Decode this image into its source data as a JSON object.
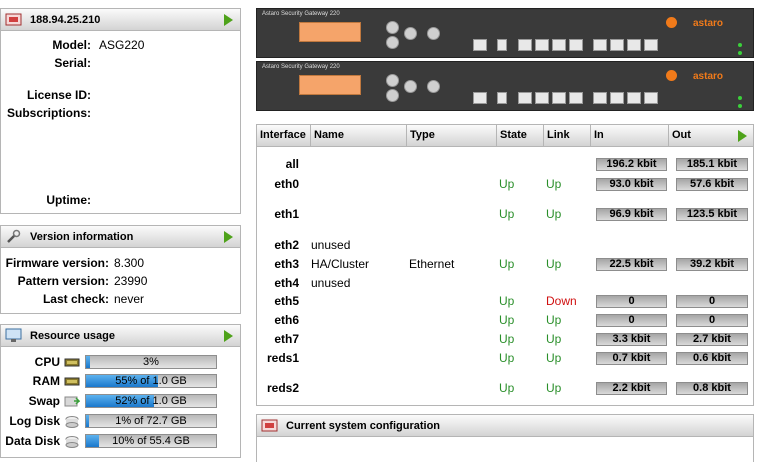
{
  "system": {
    "host": "188.94.25.210",
    "labels": {
      "model": "Model:",
      "serial": "Serial:",
      "license": "License ID:",
      "subscriptions": "Subscriptions:",
      "uptime": "Uptime:"
    },
    "model": "ASG220"
  },
  "version": {
    "title": "Version information",
    "labels": {
      "firmware": "Firmware version:",
      "pattern": "Pattern version:",
      "last_check": "Last check:"
    },
    "firmware": "8.300",
    "pattern": "23990",
    "last_check": "never"
  },
  "resources": {
    "title": "Resource usage",
    "items": [
      {
        "label": "CPU",
        "text": "3%",
        "pct": 3
      },
      {
        "label": "RAM",
        "text": "55% of 1.0 GB",
        "pct": 55
      },
      {
        "label": "Swap",
        "text": "52% of 1.0 GB",
        "pct": 52
      },
      {
        "label": "Log Disk",
        "text": "1% of 72.7 GB",
        "pct": 1
      },
      {
        "label": "Data Disk",
        "text": "10% of 55.4 GB",
        "pct": 10
      }
    ]
  },
  "gateway": {
    "title": "Astaro Security Gateway 220",
    "logo": "astaro",
    "port_groups": [
      "COM",
      "USB 2.0",
      "10/100/1000 PCI-X",
      "10/100/1000 PCI-X"
    ],
    "port_labels": [
      "LAN",
      "WAN",
      "DMZ",
      "HA"
    ],
    "buttons": [
      "Esc",
      "Enter"
    ],
    "leds": [
      "Power",
      "HDD"
    ]
  },
  "interfaces": {
    "headers": {
      "interface": "Interface",
      "name": "Name",
      "type": "Type",
      "state": "State",
      "link": "Link",
      "in": "In",
      "out": "Out"
    },
    "rows": [
      {
        "iface": "all",
        "name": "",
        "type": "",
        "state": "",
        "link": "",
        "in": "196.2 kbit",
        "out": "185.1 kbit"
      },
      {
        "iface": "eth0",
        "name": "",
        "type": "",
        "state": "Up",
        "link": "Up",
        "in": "93.0 kbit",
        "out": "57.6 kbit"
      },
      {
        "iface": "eth1",
        "name": "",
        "type": "",
        "state": "Up",
        "link": "Up",
        "in": "96.9 kbit",
        "out": "123.5 kbit"
      },
      {
        "iface": "eth2",
        "name": "unused",
        "type": "",
        "state": "",
        "link": "",
        "in": "",
        "out": ""
      },
      {
        "iface": "eth3",
        "name": "HA/Cluster",
        "type": "Ethernet",
        "state": "Up",
        "link": "Up",
        "in": "22.5 kbit",
        "out": "39.2 kbit"
      },
      {
        "iface": "eth4",
        "name": "unused",
        "type": "",
        "state": "",
        "link": "",
        "in": "",
        "out": ""
      },
      {
        "iface": "eth5",
        "name": "",
        "type": "",
        "state": "Up",
        "link": "Down",
        "in": "0",
        "out": "0"
      },
      {
        "iface": "eth6",
        "name": "",
        "type": "",
        "state": "Up",
        "link": "Up",
        "in": "0",
        "out": "0"
      },
      {
        "iface": "eth7",
        "name": "",
        "type": "",
        "state": "Up",
        "link": "Up",
        "in": "3.3 kbit",
        "out": "2.7 kbit"
      },
      {
        "iface": "reds1",
        "name": "",
        "type": "",
        "state": "Up",
        "link": "Up",
        "in": "0.7 kbit",
        "out": "0.6 kbit"
      },
      {
        "iface": "reds2",
        "name": "",
        "type": "",
        "state": "Up",
        "link": "Up",
        "in": "2.2 kbit",
        "out": "0.8 kbit"
      }
    ]
  },
  "config": {
    "title": "Current system configuration"
  },
  "colors": {
    "up": "#2a8f2a",
    "down": "#d01010",
    "accent": "#4ea21a",
    "bar": "#1a78cc",
    "brand": "#f07a1a"
  }
}
